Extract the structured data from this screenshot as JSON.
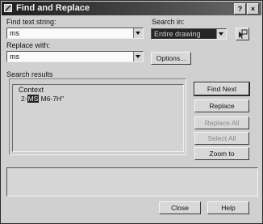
{
  "window": {
    "title": "Find and Replace",
    "help_btn": "?",
    "close_btn": "×"
  },
  "find": {
    "label": "Find text string:",
    "value": "ms"
  },
  "replace": {
    "label": "Replace with:",
    "value": "ms"
  },
  "search_in": {
    "label": "Search in:",
    "value": "Entire drawing"
  },
  "options_label": "Options...",
  "search_results": {
    "label": "Search results",
    "column_header": "Context",
    "rows": [
      {
        "prefix": "2-",
        "match": "MS",
        "suffix": " M6-7H\""
      }
    ]
  },
  "buttons": {
    "find_next": "Find Next",
    "replace": "Replace",
    "replace_all": "Replace All",
    "select_all": "Select All",
    "zoom_to": "Zoom to",
    "close": "Close",
    "help": "Help"
  },
  "colors": {
    "titlebar": "#1e1e1e",
    "dialog_bg": "#d0d0d0"
  }
}
